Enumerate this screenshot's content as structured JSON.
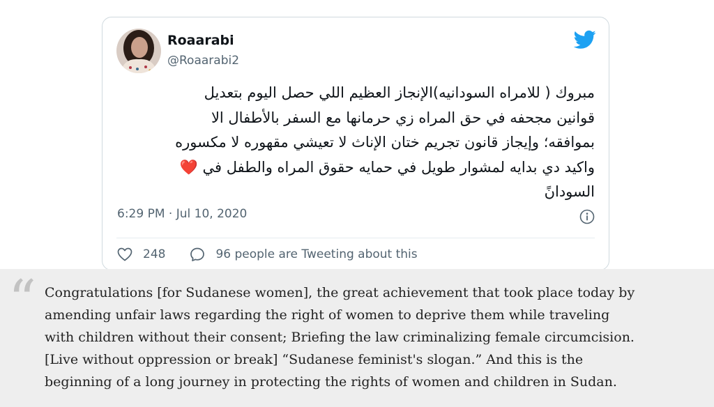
{
  "tweet": {
    "author": {
      "display_name": "Roaarabi",
      "handle": "@Roaarabi2",
      "avatar_icon": "profile-photo"
    },
    "brand_icon": "twitter-bird-icon",
    "brand_color": "#1da1f2",
    "text_lines": [
      "مبروك ( للامراه السودانيه)الإنجاز العظيم اللي حصل اليوم بتعديل",
      "قوانين مجحفه في حق المراه زي حرمانها مع السفر بالأطفال الا",
      "بموافقه؛ وإيجاز قانون تجريم ختان الإناث لا تعيشي مقهوره لا مكسوره",
      "واكيد دي بدايه لمشوار طويل في حمايه حقوق المراه والطفل في",
      "السودانً"
    ],
    "heart_emoji": "❤️",
    "heart_color": "#e0245e",
    "timestamp": "6:29 PM · Jul 10, 2020",
    "info_icon": "info-icon",
    "likes": "248",
    "like_icon": "heart-outline-icon",
    "reply_icon": "speech-bubble-icon",
    "tweeting_text": "96 people are Tweeting about this"
  },
  "translation": {
    "quote_glyph": "“",
    "lines": [
      "Congratulations [for Sudanese women], the great achievement that took place today by",
      "amending unfair laws regarding the right of women to deprive them while traveling",
      "with children without their consent; Briefing the law criminalizing female circumcision.",
      "[Live without oppression or break] “Sudanese feminist's slogan.” And this is the",
      "beginning of a long journey in protecting the rights of women and children in Sudan."
    ]
  }
}
